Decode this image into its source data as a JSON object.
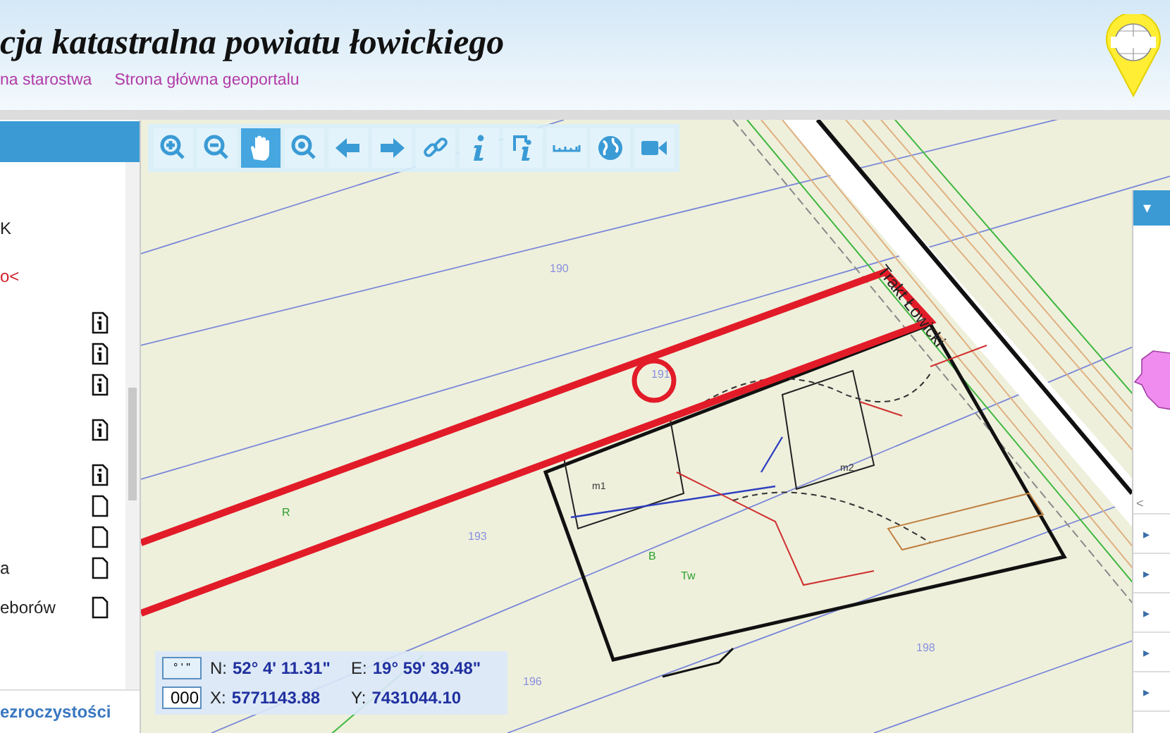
{
  "header": {
    "title": "cja katastralna powiatu łowickiego",
    "links": [
      "na starostwa",
      "Strona główna geoportalu"
    ]
  },
  "left_panel": {
    "items": [
      {
        "kind": "label",
        "text": "K"
      },
      {
        "kind": "alert",
        "text": "o<"
      },
      {
        "kind": "info-file"
      },
      {
        "kind": "info-file"
      },
      {
        "kind": "info-file"
      },
      {
        "kind": "info-file"
      },
      {
        "kind": "info-file"
      },
      {
        "kind": "file"
      },
      {
        "kind": "file"
      },
      {
        "kind": "file",
        "text": "a"
      },
      {
        "kind": "file",
        "text": "eborów"
      }
    ],
    "footer_link": "ezroczystości"
  },
  "toolbar": {
    "tools": [
      {
        "kind": "zoom-in",
        "selected": false
      },
      {
        "kind": "zoom-out",
        "selected": false
      },
      {
        "kind": "pan",
        "selected": true
      },
      {
        "kind": "zoom-extent",
        "selected": false
      },
      {
        "kind": "back",
        "selected": false
      },
      {
        "kind": "forward",
        "selected": false
      },
      {
        "kind": "link",
        "selected": false
      },
      {
        "kind": "info",
        "selected": false
      },
      {
        "kind": "info-doc",
        "selected": false
      },
      {
        "kind": "ruler",
        "selected": false
      },
      {
        "kind": "globe",
        "selected": false
      },
      {
        "kind": "camera",
        "selected": false
      }
    ]
  },
  "map": {
    "labels": [
      {
        "text": "190",
        "kind": "parcel"
      },
      {
        "text": "191",
        "kind": "parcel"
      },
      {
        "text": "193",
        "kind": "parcel"
      },
      {
        "text": "196",
        "kind": "parcel"
      },
      {
        "text": "198",
        "kind": "parcel"
      },
      {
        "text": "R",
        "kind": "use"
      },
      {
        "text": "B",
        "kind": "use"
      },
      {
        "text": "Tw",
        "kind": "use"
      },
      {
        "text": "m1",
        "kind": "building"
      },
      {
        "text": "m2",
        "kind": "building"
      },
      {
        "text": "Trakt Łowicki",
        "kind": "street"
      }
    ]
  },
  "coordinates": {
    "format_button": "° ' \"",
    "scale_value": "000",
    "n_label": "N:",
    "n_value": "52° 4' 11.31\"",
    "e_label": "E:",
    "e_value": "19° 59' 39.48\"",
    "x_label": "X:",
    "x_value": "5771143.88",
    "y_label": "Y:",
    "y_value": "7431044.10"
  },
  "right_panel": {
    "header_caret": "▾",
    "scroll_arrow": "<",
    "rows": [
      "▸",
      "▸",
      "▸",
      "▸",
      "▸"
    ]
  }
}
